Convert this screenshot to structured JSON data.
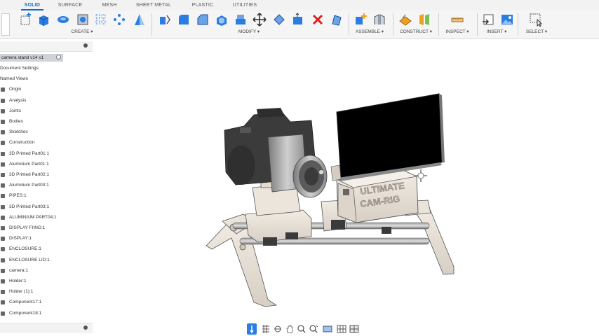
{
  "tabs": [
    {
      "label": "SOLID",
      "active": true
    },
    {
      "label": "SURFACE",
      "active": false
    },
    {
      "label": "MESH",
      "active": false
    },
    {
      "label": "SHEET METAL",
      "active": false
    },
    {
      "label": "PLASTIC",
      "active": false
    },
    {
      "label": "UTILITIES",
      "active": false
    }
  ],
  "toolbar": {
    "groups": [
      {
        "label": "CREATE ▾"
      },
      {
        "label": "MODIFY ▾"
      },
      {
        "label": "ASSEMBLE ▾"
      },
      {
        "label": "CONSTRUCT ▾"
      },
      {
        "label": "INSPECT ▾"
      },
      {
        "label": "INSERT ▾"
      },
      {
        "label": "SELECT ▾"
      }
    ]
  },
  "browser": {
    "root": "camera stand v14 v1",
    "items": [
      "Document Settings",
      "Named Views",
      "Origin",
      "Analysis",
      "Joints",
      "Bodies",
      "Sketches",
      "Construction",
      "3D Printed Part01:1",
      "Aluminium Part01:1",
      "3D Printed Part02:1",
      "Aluminium Part03:1",
      "PIPES:1",
      "3D Printed Part03:1",
      "ALUMINIUM PART04:1",
      "DISPLAY FIING:1",
      "DISPLAY:1",
      "ENCLOSURE:1",
      "ENCLOSURE LID:1",
      "camera:1",
      "Holder:1",
      "Holder (1):1",
      "Component17:1",
      "Component18:1"
    ]
  },
  "model": {
    "enclosure_text_line1": "ULTIMATE",
    "enclosure_text_line2": "CAM-RIG"
  },
  "colors": {
    "accent": "#0b6fc1",
    "panel_bg": "#f3f3f3",
    "model_tan": "#ece5dc"
  }
}
